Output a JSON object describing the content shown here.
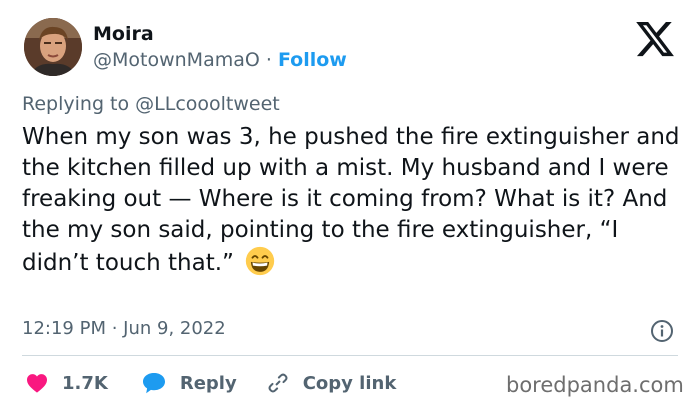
{
  "header": {
    "display_name": "Moira",
    "handle": "@MotownMamaO",
    "separator": " · ",
    "follow_label": "Follow"
  },
  "reply_context": {
    "prefix": "Replying to ",
    "mention": "@LLcoooltweet"
  },
  "tweet": {
    "text": "When my son was 3, he pushed the fire extinguisher and the kitchen filled up with a mist. My husband and I were freaking out — Where is it coming from? What is it? And the my son said, pointing to the fire extinguisher, “I didn’t touch that.”",
    "emoji": "grinning-face-with-smiling-eyes"
  },
  "meta": {
    "timestamp": "12:19 PM · Jun 9, 2022"
  },
  "actions": {
    "like_count": "1.7K",
    "reply_label": "Reply",
    "copy_link_label": "Copy link"
  },
  "watermark": "boredpanda.com",
  "colors": {
    "text": "#0f1419",
    "secondary": "#536471",
    "link_blue": "#1d9bf0",
    "like_red": "#f91880",
    "reply_blue": "#1d9bf0",
    "divider": "#cfd9de"
  },
  "icons": {
    "logo": "x-logo-icon",
    "info": "info-icon",
    "like": "heart-icon",
    "reply": "speech-bubble-icon",
    "copy_link": "link-icon"
  }
}
